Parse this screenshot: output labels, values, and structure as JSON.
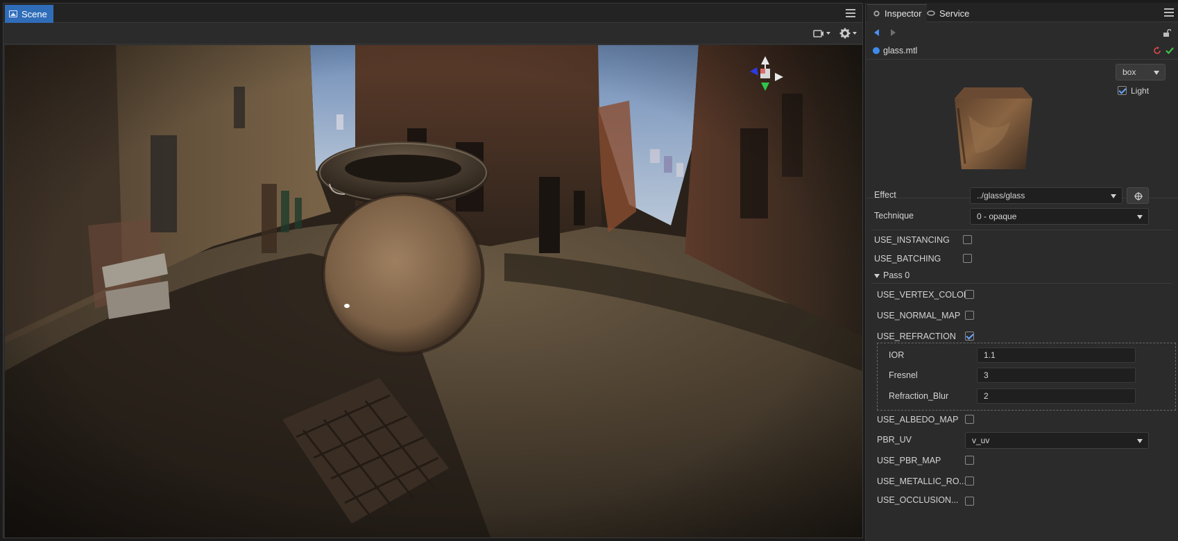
{
  "scene": {
    "tab_label": "Scene",
    "colors": {
      "tab_active": "#2f6db9"
    }
  },
  "inspector": {
    "tabs": [
      {
        "label": "Inspector"
      },
      {
        "label": "Service"
      }
    ],
    "file_name": "glass.mtl",
    "preview": {
      "mesh_select": "box",
      "light_label": "Light",
      "light_checked": true
    },
    "effect": {
      "label": "Effect",
      "value": "../glass/glass"
    },
    "technique": {
      "label": "Technique",
      "value": "0 - opaque"
    },
    "use_instancing": {
      "label": "USE_INSTANCING",
      "checked": false
    },
    "use_batching": {
      "label": "USE_BATCHING",
      "checked": false
    },
    "pass_label": "Pass 0",
    "pass": {
      "use_vertex_color": {
        "label": "USE_VERTEX_COLOR",
        "checked": false
      },
      "use_normal_map": {
        "label": "USE_NORMAL_MAP",
        "checked": false
      },
      "use_refraction": {
        "label": "USE_REFRACTION",
        "checked": true
      },
      "ior": {
        "label": "IOR",
        "value": "1.1"
      },
      "fresnel": {
        "label": "Fresnel",
        "value": "3"
      },
      "refraction_blur": {
        "label": "Refraction_Blur",
        "value": "2"
      },
      "use_albedo_map": {
        "label": "USE_ALBEDO_MAP",
        "checked": false
      },
      "pbr_uv": {
        "label": "PBR_UV",
        "value": "v_uv"
      },
      "use_pbr_map": {
        "label": "USE_PBR_MAP",
        "checked": false
      },
      "use_metallic_ro": {
        "label": "USE_METALLIC_RO...",
        "checked": false
      },
      "use_occlusion": {
        "label": "USE_OCCLUSION...",
        "checked": false
      }
    }
  }
}
